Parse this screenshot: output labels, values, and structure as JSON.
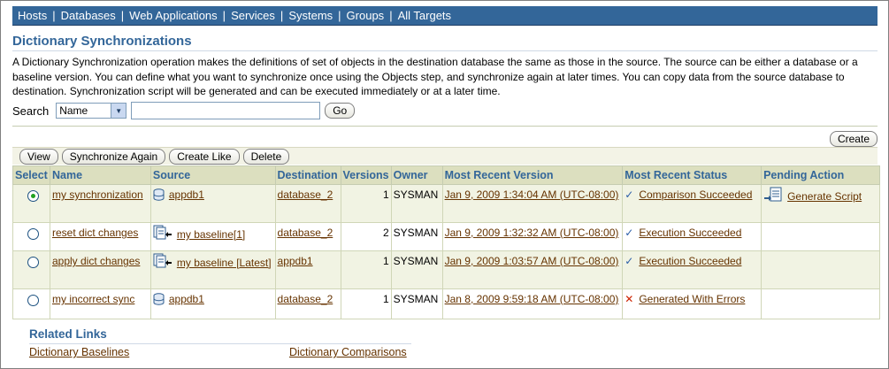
{
  "nav": {
    "items": [
      "Hosts",
      "Databases",
      "Web Applications",
      "Services",
      "Systems",
      "Groups",
      "All Targets"
    ],
    "separator": "|"
  },
  "page": {
    "title": "Dictionary Synchronizations",
    "description": "A Dictionary Synchronization operation makes the definitions of set of objects in the destination database the same as those in the source. The source can be either a database or a baseline version. You can define what you want to synchronize once using the Objects step, and synchronize again at later times. You can copy data from the source database to destination. Synchronization script will be generated and can be executed immediately or at a later time."
  },
  "search": {
    "label": "Search",
    "select_value": "Name",
    "input_value": "",
    "go_label": "Go"
  },
  "actions": {
    "create_label": "Create",
    "view_label": "View",
    "sync_again_label": "Synchronize Again",
    "create_like_label": "Create Like",
    "delete_label": "Delete"
  },
  "table": {
    "headers": {
      "select": "Select",
      "name": "Name",
      "source": "Source",
      "destination": "Destination",
      "versions": "Versions",
      "owner": "Owner",
      "recent_version": "Most Recent Version",
      "recent_status": "Most Recent Status",
      "pending": "Pending Action"
    },
    "rows": [
      {
        "selected": true,
        "name": "my synchronization",
        "source_icon": "database-icon",
        "source": "appdb1",
        "destination": "database_2",
        "versions": "1",
        "owner": "SYSMAN",
        "recent_version": "Jan 9, 2009 1:34:04 AM (UTC-08:00)",
        "status_icon": "check-icon",
        "status": "Comparison Succeeded",
        "pending": "Generate Script"
      },
      {
        "selected": false,
        "name": "reset dict changes",
        "source_icon": "baseline-icon",
        "source": "my baseline[1]",
        "destination": "database_2",
        "versions": "2",
        "owner": "SYSMAN",
        "recent_version": "Jan 9, 2009 1:32:32 AM (UTC-08:00)",
        "status_icon": "check-icon",
        "status": "Execution Succeeded",
        "pending": ""
      },
      {
        "selected": false,
        "name": "apply dict changes",
        "source_icon": "baseline-icon",
        "source": "my baseline [Latest]",
        "destination": "appdb1",
        "versions": "1",
        "owner": "SYSMAN",
        "recent_version": "Jan 9, 2009 1:03:57 AM (UTC-08:00)",
        "status_icon": "check-icon",
        "status": "Execution Succeeded",
        "pending": ""
      },
      {
        "selected": false,
        "name": "my incorrect sync",
        "source_icon": "database-icon",
        "source": "appdb1",
        "destination": "database_2",
        "versions": "1",
        "owner": "SYSMAN",
        "recent_version": "Jan 8, 2009 9:59:18 AM (UTC-08:00)",
        "status_icon": "error-x-icon",
        "status": "Generated With Errors",
        "pending": ""
      }
    ]
  },
  "related": {
    "title": "Related Links",
    "links": [
      "Dictionary Baselines",
      "Dictionary Comparisons"
    ]
  },
  "colors": {
    "nav_bg": "#336699",
    "header_bg": "#dcdfbf",
    "link": "#663300",
    "title": "#336699"
  }
}
